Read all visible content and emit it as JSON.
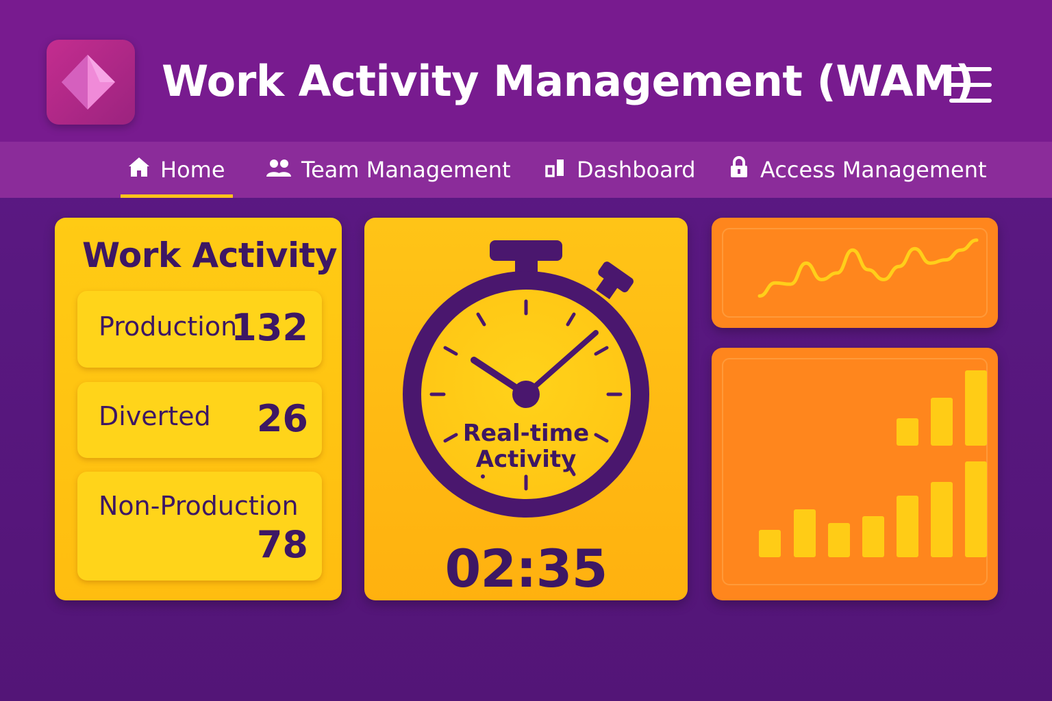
{
  "app": {
    "title": "Work Activity Management (WAM)",
    "logo_icon": "power-apps-diamond-icon",
    "menu_icon": "hamburger-menu-icon"
  },
  "nav": {
    "active": "Home",
    "items": [
      {
        "label": "Home",
        "icon": "home-icon"
      },
      {
        "label": "Team Management",
        "icon": "people-icon"
      },
      {
        "label": "Dashboard",
        "icon": "dashboard-icon"
      },
      {
        "label": "Access Management",
        "icon": "lock-icon"
      }
    ]
  },
  "work_activity": {
    "title": "Work Activity",
    "stats": [
      {
        "label": "Production",
        "value": "132"
      },
      {
        "label": "Diverted",
        "value": "26"
      },
      {
        "label": "Non-Production",
        "value": "78"
      }
    ]
  },
  "timer": {
    "label_line1": "Real-time",
    "label_line2": "Activity",
    "readout": "02:35",
    "icon": "stopwatch-icon"
  },
  "colors": {
    "header_bg": "#781b8f",
    "nav_bg": "#8b2c9a",
    "page_bg": "#5a1883",
    "accent_yellow": "#ffc21c",
    "accent_orange": "#ff861d",
    "text_dark": "#3d1764"
  },
  "chart_data": [
    {
      "type": "line",
      "x": [
        1,
        2,
        3,
        4,
        5,
        6,
        7,
        8,
        9,
        10,
        11,
        12,
        13,
        14,
        15
      ],
      "values": [
        10,
        30,
        28,
        60,
        35,
        45,
        80,
        50,
        35,
        55,
        82,
        60,
        65,
        80,
        95
      ]
    },
    {
      "type": "bar",
      "rows": [
        {
          "values": [
            0,
            0,
            0,
            0,
            4,
            7,
            11
          ]
        },
        {
          "values": [
            4,
            7,
            5,
            6,
            9,
            11,
            14
          ]
        }
      ]
    }
  ]
}
